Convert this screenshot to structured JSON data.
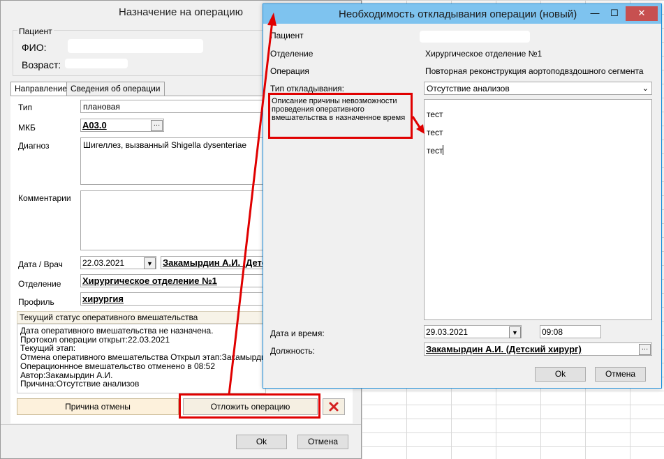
{
  "main_window": {
    "title": "Назначение на операцию",
    "patient_group": "Пациент",
    "fio_label": "ФИО:",
    "age_label": "Возраст:",
    "tabs": [
      "Направление",
      "Сведения об операции"
    ],
    "type_label": "Тип",
    "type_value": "плановая",
    "mkb_label": "МКБ",
    "mkb_value": "A03.0",
    "diagnosis_label": "Диагноз",
    "diagnosis_value": "Шигеллез, вызванный Shigella dysenteriae",
    "comments_label": "Комментарии",
    "date_doctor_label": "Дата / Врач",
    "date_value": "22.03.2021",
    "doctor_value": "Закамырдин А.И. (Детск",
    "department_label": "Отделение",
    "department_value": "Хирургическое отделение №1",
    "profile_label": "Профиль",
    "profile_value": "хирургия",
    "status_header": "Текущий статус оперативного вмешательства",
    "status_lines": [
      "Дата оперативного вмешательства не назначена.",
      "Протокол операции открыт:22.03.2021",
      "Текущий этап:",
      "Отмена оперативного вмешательства Открыл этап:Закамырдин А.И.",
      "Операционнное вмешательство отменено в 08:52",
      "Автор:Закамырдин А.И.",
      "Причина:Отсутствие анализов"
    ],
    "cancel_reason_button": "Причина отмены",
    "postpone_button": "Отложить операцию",
    "ok_button": "Ok",
    "cancel_button": "Отмена"
  },
  "dialog": {
    "title": "Необходимость откладывания операции (новый)",
    "patient_label": "Пациент",
    "department_label": "Отделение",
    "department_value": "Хирургическое отделение №1",
    "operation_label": "Операция",
    "operation_value": "Повторная реконструкция аортоподвздошного сегмента",
    "postpone_type_label": "Тип откладывания:",
    "postpone_type_value": "Отсутствие анализов",
    "description_label": "Описание причины невозможности проведения оперативного вмешательства в назначенное время",
    "description_lines": [
      "тест",
      "тест",
      "тест"
    ],
    "datetime_label": "Дата и время:",
    "date_value": "29.03.2021",
    "time_value": "09:08",
    "position_label": "Должность:",
    "position_value": "Закамырдин А.И. (Детский хирург)",
    "ok_button": "Ok",
    "cancel_button": "Отмена",
    "window_controls": [
      "—",
      "☐",
      "✕"
    ]
  },
  "colors": {
    "dialog_titlebar": "#7ec3ef",
    "highlight_red": "#e00000",
    "close_button": "#c75050",
    "reason_button_bg": "#fdf1dc"
  },
  "icons": {
    "delete": "red-x-icon",
    "ellipsis": "ellipsis-icon",
    "dropdown": "chevron-down-icon"
  }
}
